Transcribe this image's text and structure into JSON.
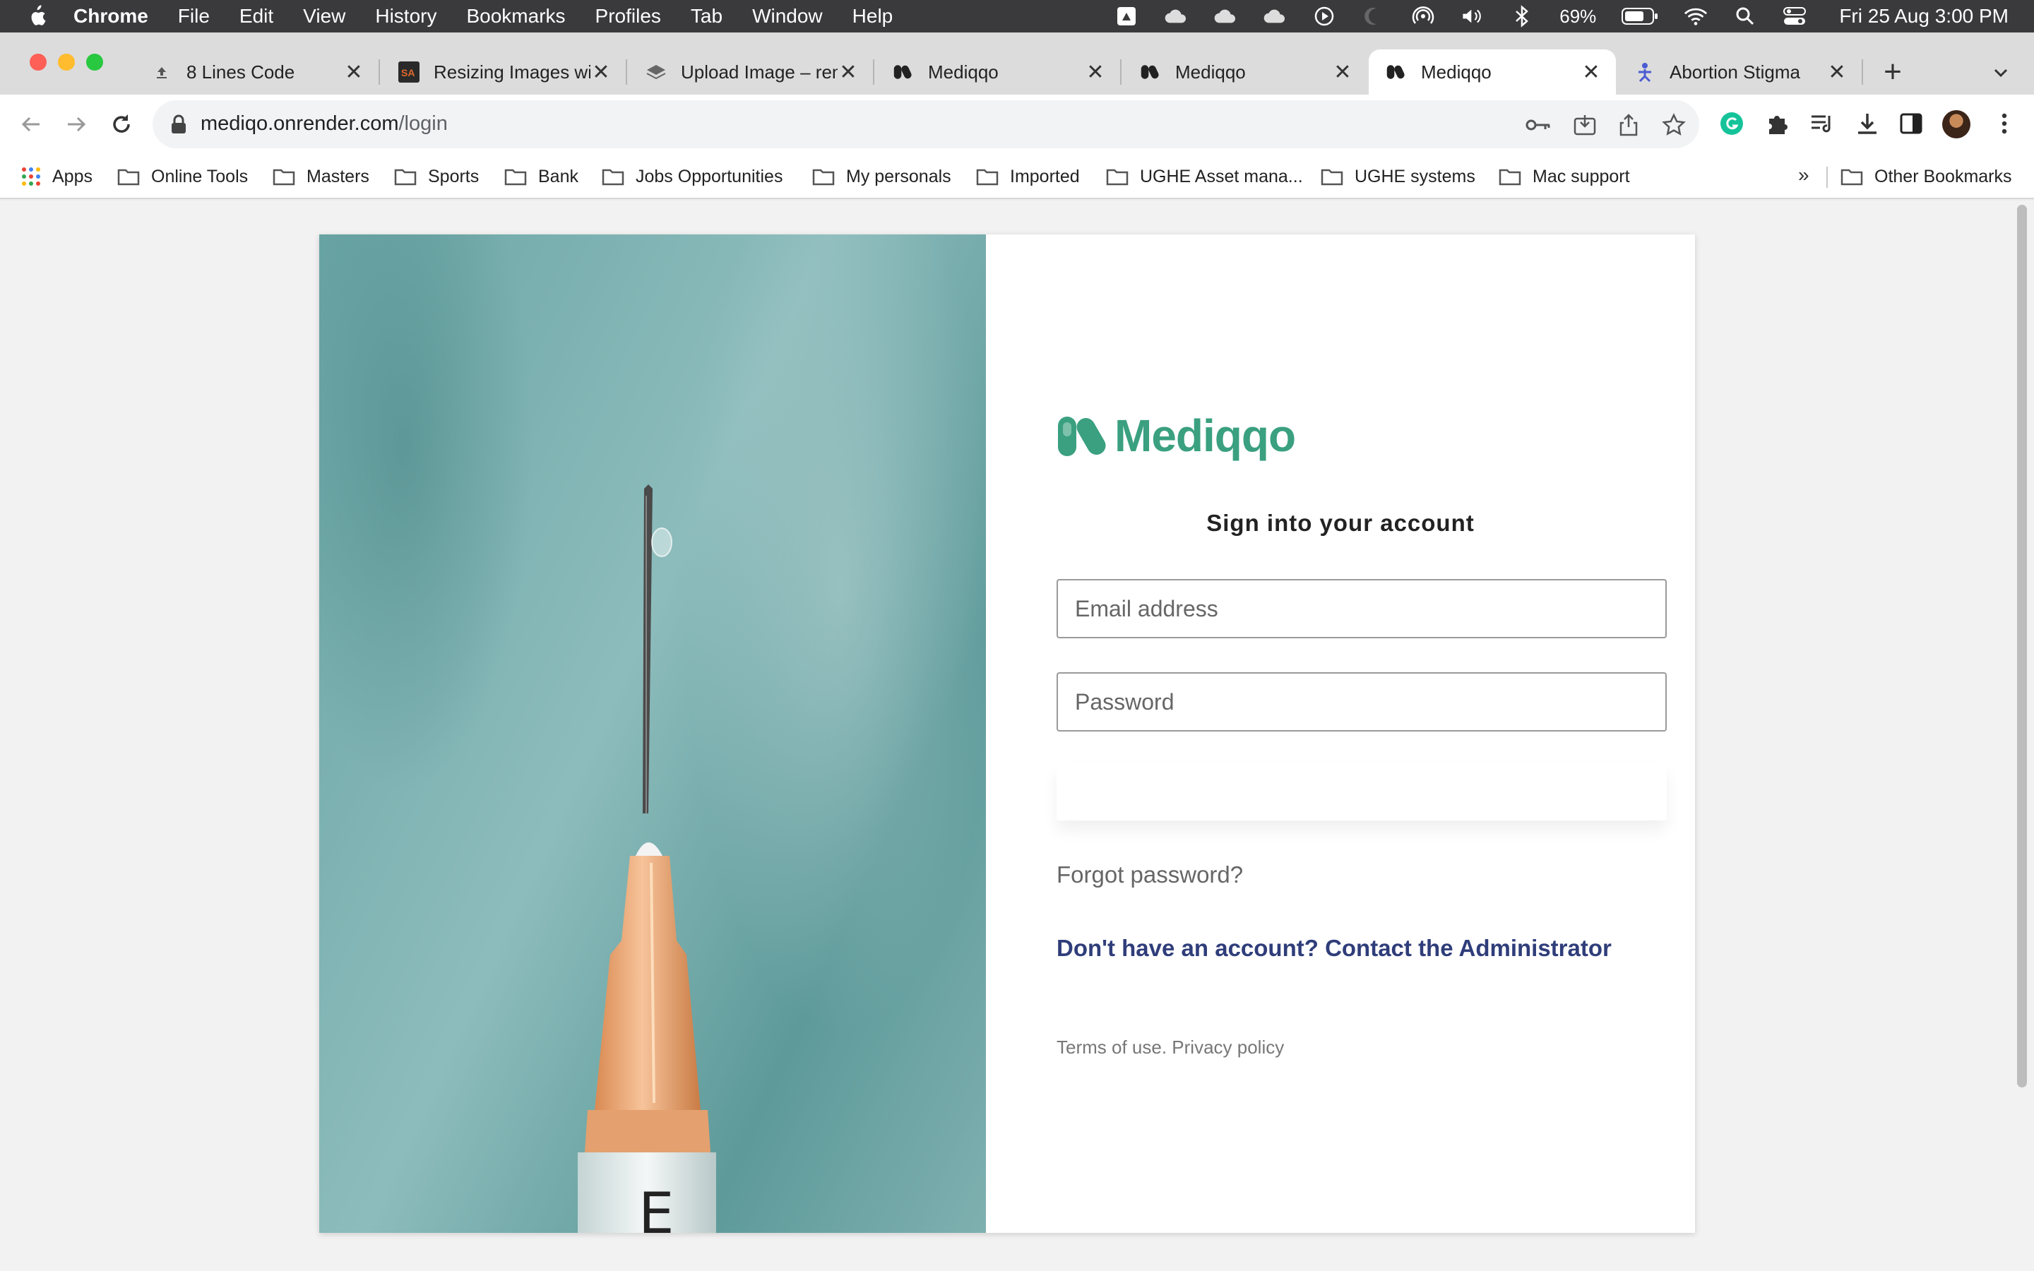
{
  "menubar": {
    "app_name": "Chrome",
    "items": [
      "File",
      "Edit",
      "View",
      "History",
      "Bookmarks",
      "Profiles",
      "Tab",
      "Window",
      "Help"
    ],
    "battery": "69%",
    "clock": "Fri 25 Aug  3:00 PM"
  },
  "tabs": [
    {
      "title": "8 Lines Code",
      "icon": "upload-icon"
    },
    {
      "title": "Resizing Images wi",
      "icon": "sa-favicon"
    },
    {
      "title": "Upload Image – ren",
      "icon": "layers-icon"
    },
    {
      "title": "Mediqqo",
      "icon": "mediqqo-favicon"
    },
    {
      "title": "Mediqqo",
      "icon": "mediqqo-favicon"
    },
    {
      "title": "Mediqqo",
      "icon": "mediqqo-favicon",
      "active": true
    },
    {
      "title": "Abortion Stigma",
      "icon": "figure-icon"
    }
  ],
  "address_bar": {
    "host": "mediqo.onrender.com",
    "path": "/login"
  },
  "bookmarks": {
    "apps_label": "Apps",
    "items": [
      "Online Tools",
      "Masters",
      "Sports",
      "Bank",
      "Jobs Opportunities",
      "My personals",
      "Imported",
      "UGHE Asset mana...",
      "UGHE systems",
      "Mac support"
    ],
    "overflow": "»",
    "other": "Other Bookmarks"
  },
  "login": {
    "brand": "Mediqqo",
    "heading": "Sign into your account",
    "email_placeholder": "Email address",
    "password_placeholder": "Password",
    "forgot": "Forgot password?",
    "signup": "Don't have an account? Contact the Administrator",
    "terms": "Terms of use.",
    "privacy": "Privacy policy",
    "hero_label": "E"
  },
  "colors": {
    "brand": "#3aa07f",
    "link": "#2f3d7a",
    "hero": "#6aa5a5"
  }
}
